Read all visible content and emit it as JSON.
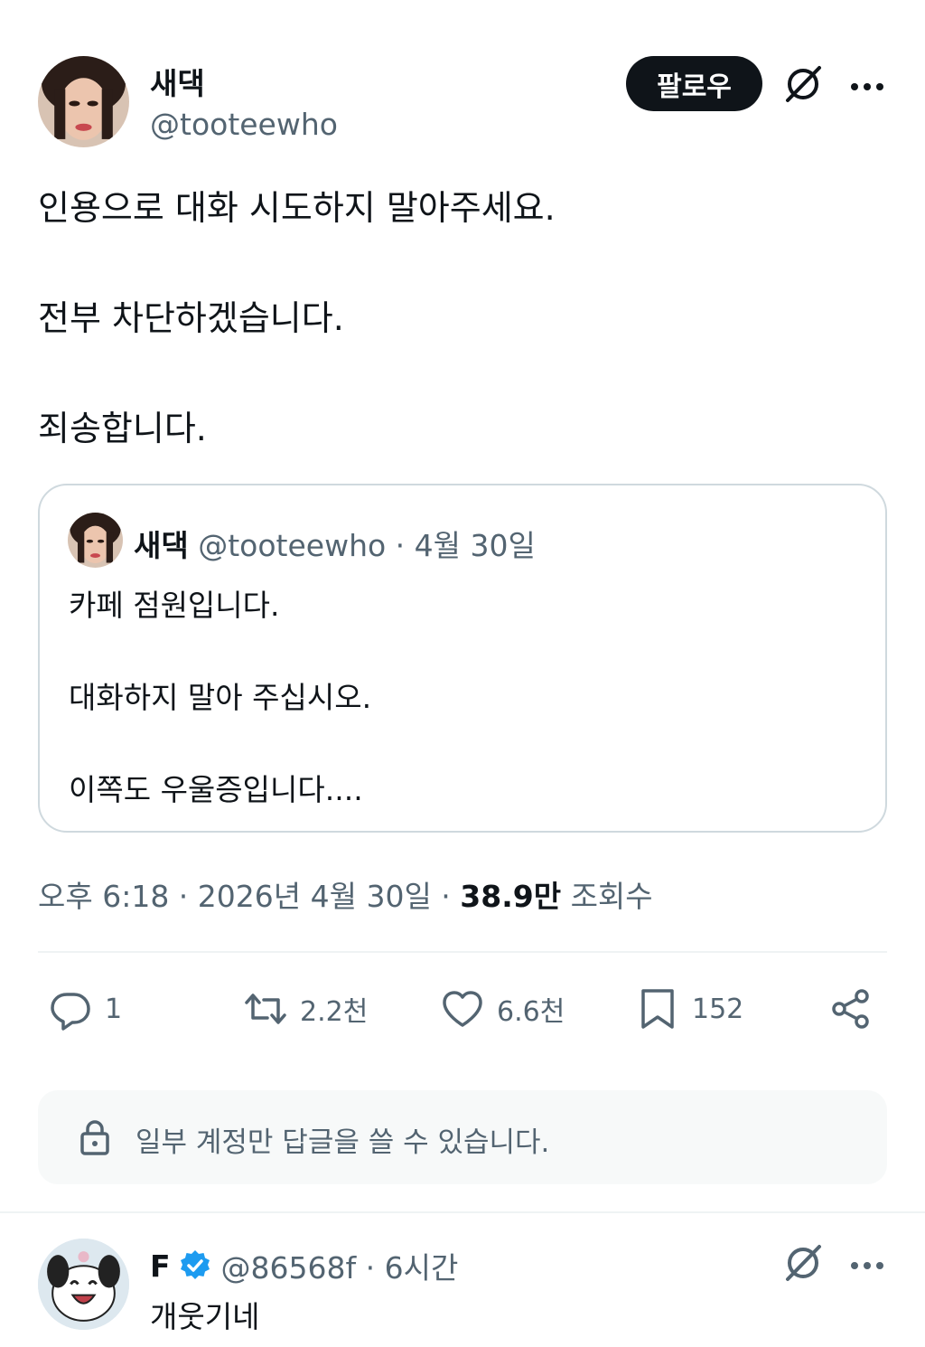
{
  "post": {
    "author_name": "새댁",
    "author_handle": "@tooteewho",
    "follow_label": "팔로우",
    "lines": [
      "인용으로 대화 시도하지 말아주세요.",
      "전부 차단하겠습니다.",
      "죄송합니다."
    ],
    "time": "오후 6:18 · 2026년 4월 30일 · ",
    "views_count": "38.9만",
    "views_label": " 조회수"
  },
  "quote": {
    "author_name": "새댁",
    "meta": " @tooteewho · 4월 30일",
    "lines": [
      "카페 점원입니다.",
      "대화하지 말아 주십시오.",
      "이쪽도 우울증입니다...."
    ]
  },
  "actions": {
    "replies": "1",
    "reposts": "2.2천",
    "likes": "6.6천",
    "bookmarks": "152"
  },
  "reply_restriction": "일부 계정만 답글을 쓸 수 있습니다.",
  "reply": {
    "author_name": "F",
    "meta": "@86568f · 6시간",
    "text": "개웃기네"
  },
  "icons": {
    "grok": "grok-icon",
    "more": "more-icon",
    "reply": "reply-icon",
    "repost": "repost-icon",
    "like": "heart-icon",
    "bookmark": "bookmark-icon",
    "share": "share-icon",
    "lock": "lock-icon",
    "verified": "verified-badge-icon"
  },
  "colors": {
    "text": "#0f1419",
    "secondary": "#536471",
    "verified": "#1d9bf0",
    "follow_bg": "#0f1419"
  }
}
